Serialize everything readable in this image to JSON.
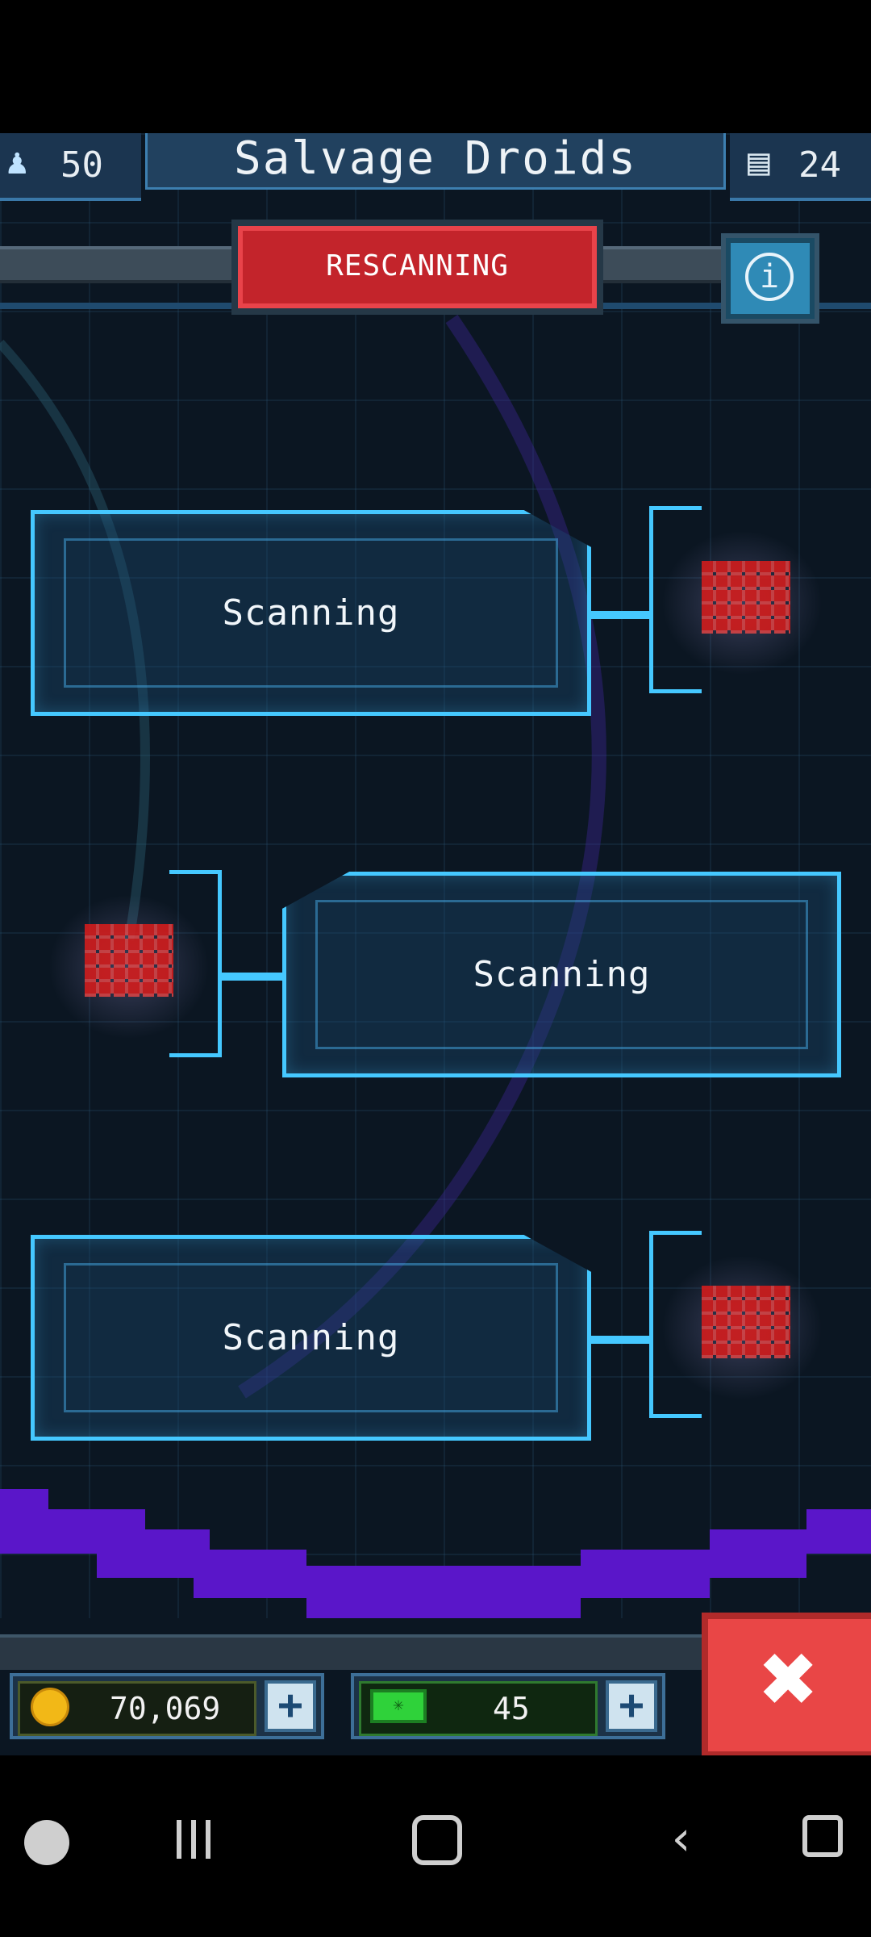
{
  "header": {
    "crew_count": "50",
    "title": "Salvage Droids",
    "storage_count": "24"
  },
  "rescan_button": {
    "label": "RESCANNING"
  },
  "info_button": {
    "label": "i"
  },
  "slots": [
    {
      "label": "Scanning"
    },
    {
      "label": "Scanning"
    },
    {
      "label": "Scanning"
    }
  ],
  "resources": {
    "coins": "70,069",
    "gems": "45",
    "plus_symbol": "+"
  },
  "close_button": {
    "label": "✖"
  },
  "colors": {
    "accent_cyan": "#45c8ff",
    "rescan_red": "#c3242b",
    "purple_band": "#5a16c9"
  }
}
